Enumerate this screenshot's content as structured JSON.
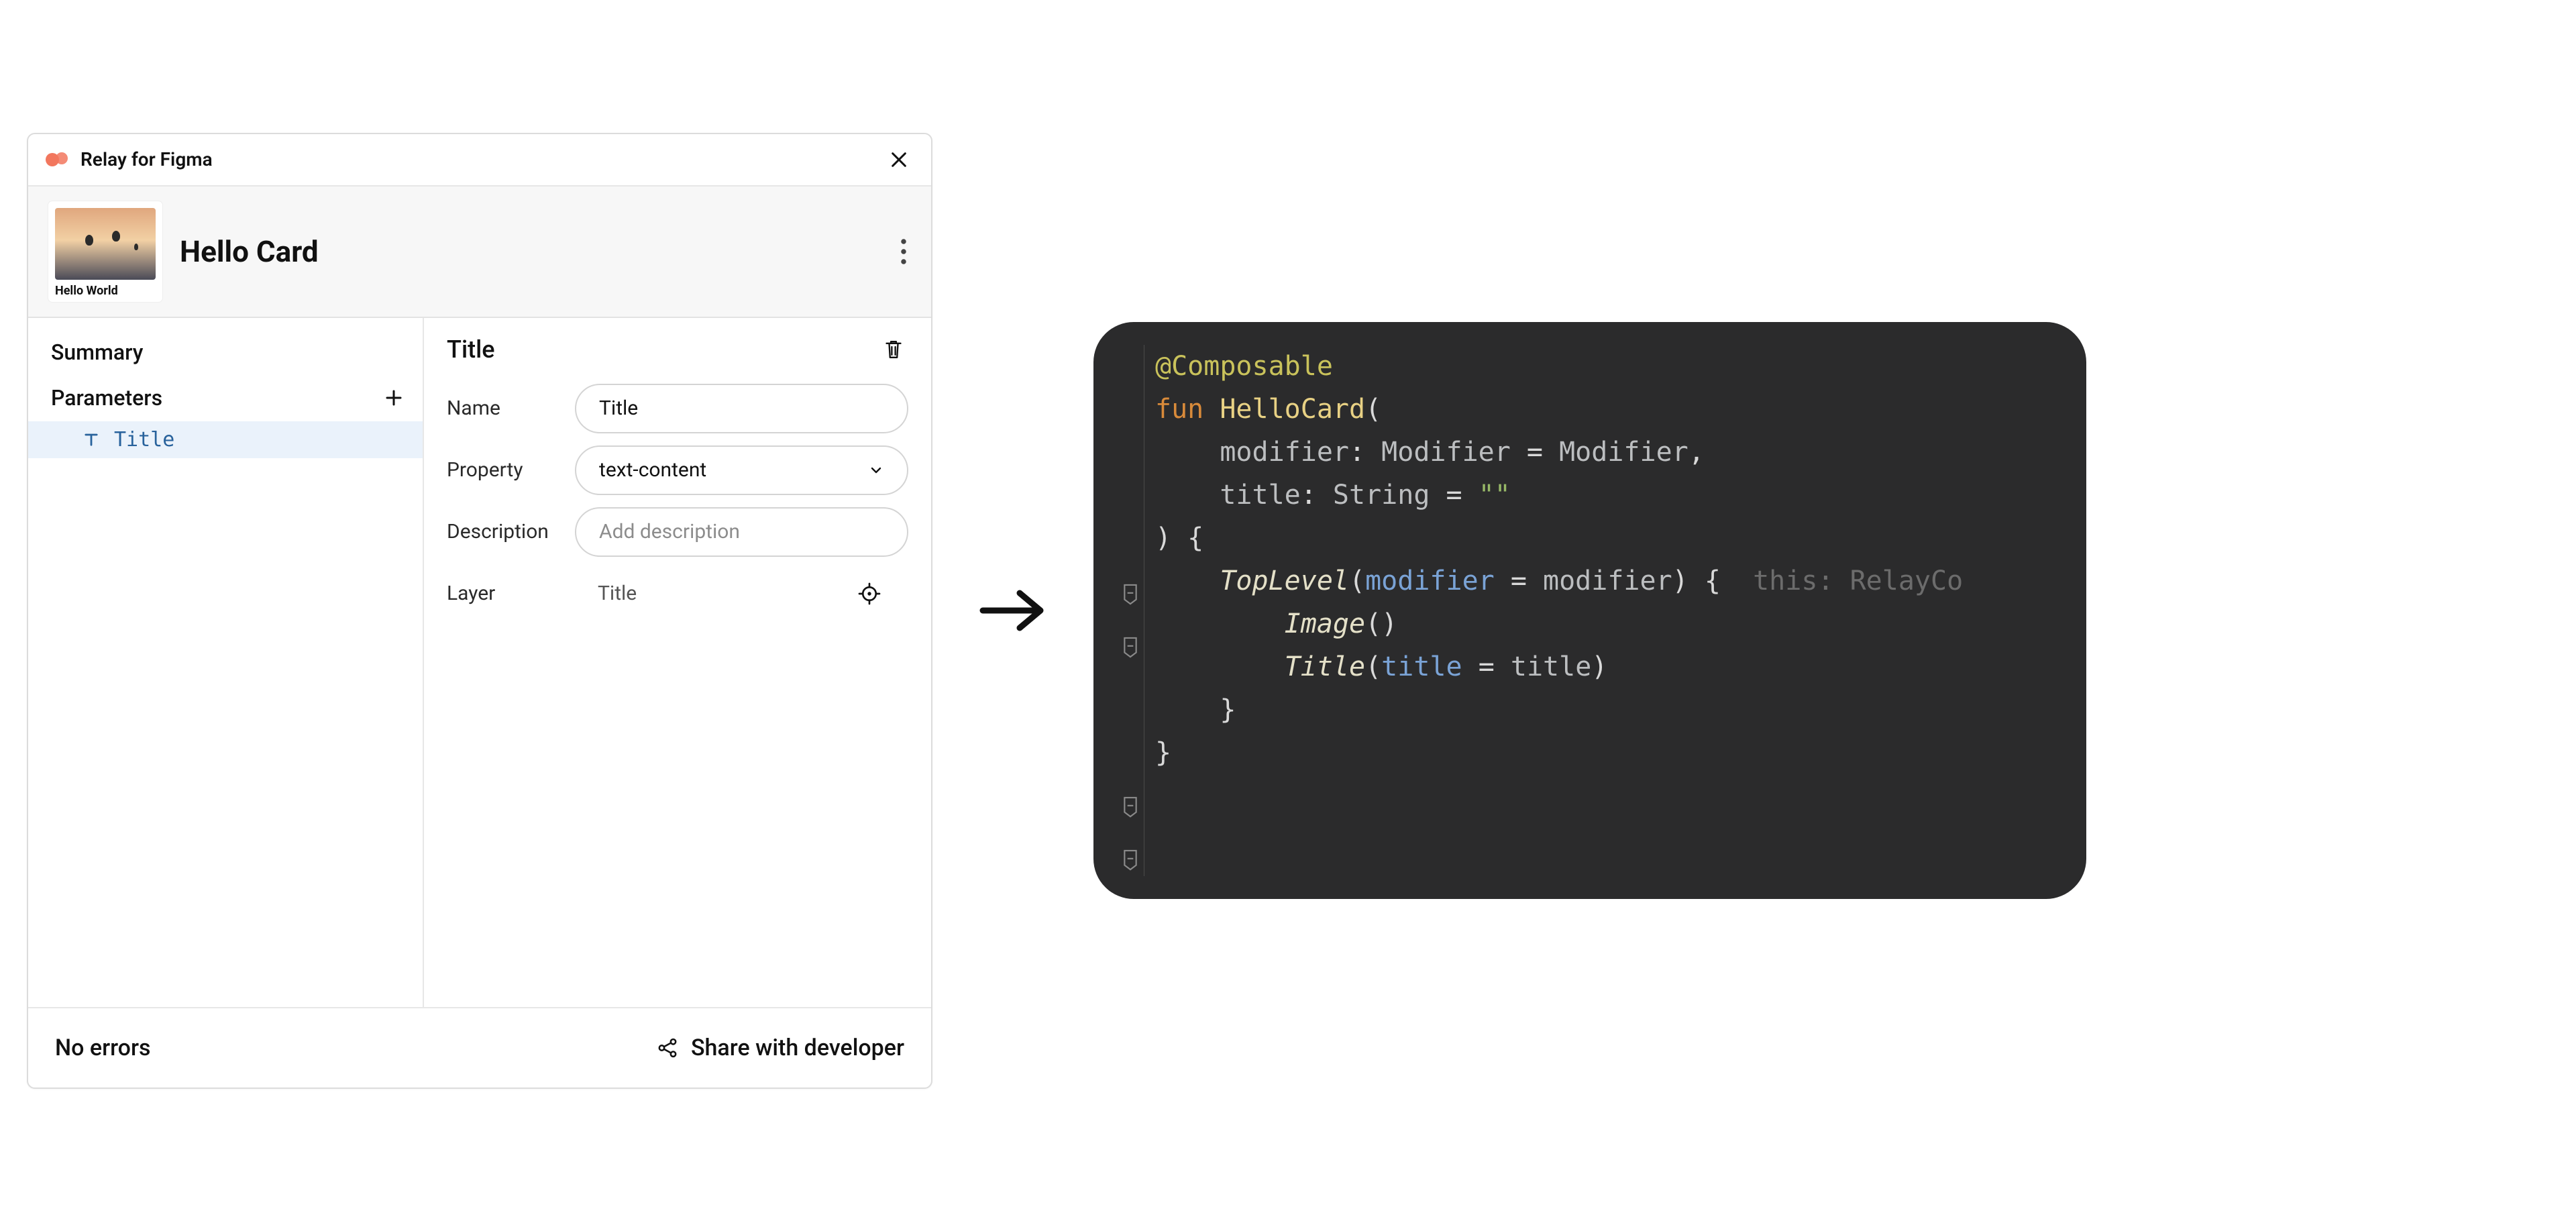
{
  "panel": {
    "plugin_name": "Relay for Figma",
    "component_name": "Hello Card",
    "thumbnail_caption": "Hello World",
    "sidebar": {
      "summary_label": "Summary",
      "parameters_label": "Parameters",
      "items": [
        {
          "label": "Title"
        }
      ]
    },
    "detail": {
      "title": "Title",
      "fields": {
        "name": {
          "label": "Name",
          "value": "Title"
        },
        "property": {
          "label": "Property",
          "value": "text-content"
        },
        "description": {
          "label": "Description",
          "placeholder": "Add description"
        },
        "layer": {
          "label": "Layer",
          "value": "Title"
        }
      }
    },
    "footer": {
      "status": "No errors",
      "share_label": "Share with developer"
    }
  },
  "code": {
    "annotation": "@Composable",
    "keyword_fun": "fun",
    "fn_name": "HelloCard",
    "param_modifier_name": "modifier",
    "type_modifier": "Modifier",
    "eq": "=",
    "default_modifier": "Modifier",
    "param_title_name": "title",
    "type_string": "String",
    "default_title": "\"\"",
    "call_toplevel": "TopLevel",
    "named_modifier": "modifier",
    "arg_modifier": "modifier",
    "hint_receiver": "this: RelayCo",
    "call_image": "Image",
    "call_title": "Title",
    "named_title": "title",
    "arg_title": "title"
  }
}
